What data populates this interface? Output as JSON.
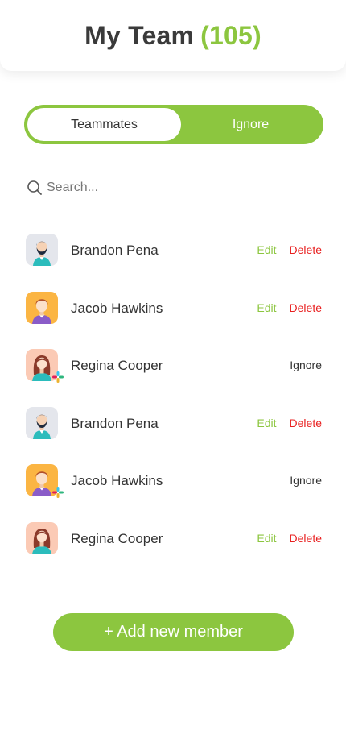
{
  "header": {
    "title": "My Team",
    "count": "(105)"
  },
  "tabs": [
    {
      "label": "Teammates",
      "active": true
    },
    {
      "label": "Ignore",
      "active": false
    }
  ],
  "search": {
    "placeholder": "Search..."
  },
  "colors": {
    "accent": "#8cc63f",
    "delete": "#e81f1f"
  },
  "members": [
    {
      "name": "Brandon Pena",
      "avatar": "man-beard-avatar",
      "slack": false,
      "actions": {
        "edit": "Edit",
        "delete": "Delete"
      }
    },
    {
      "name": "Jacob Hawkins",
      "avatar": "man-orange-avatar",
      "slack": false,
      "actions": {
        "edit": "Edit",
        "delete": "Delete"
      }
    },
    {
      "name": "Regina Cooper",
      "avatar": "woman-avatar",
      "slack": true,
      "actions": {
        "ignore": "Ignore"
      }
    },
    {
      "name": "Brandon Pena",
      "avatar": "man-beard-avatar",
      "slack": false,
      "actions": {
        "edit": "Edit",
        "delete": "Delete"
      }
    },
    {
      "name": "Jacob Hawkins",
      "avatar": "man-orange-avatar",
      "slack": true,
      "actions": {
        "ignore": "Ignore"
      }
    },
    {
      "name": "Regina Cooper",
      "avatar": "woman-avatar",
      "slack": false,
      "actions": {
        "edit": "Edit",
        "delete": "Delete"
      }
    }
  ],
  "add_button": {
    "label": "+ Add new member"
  }
}
